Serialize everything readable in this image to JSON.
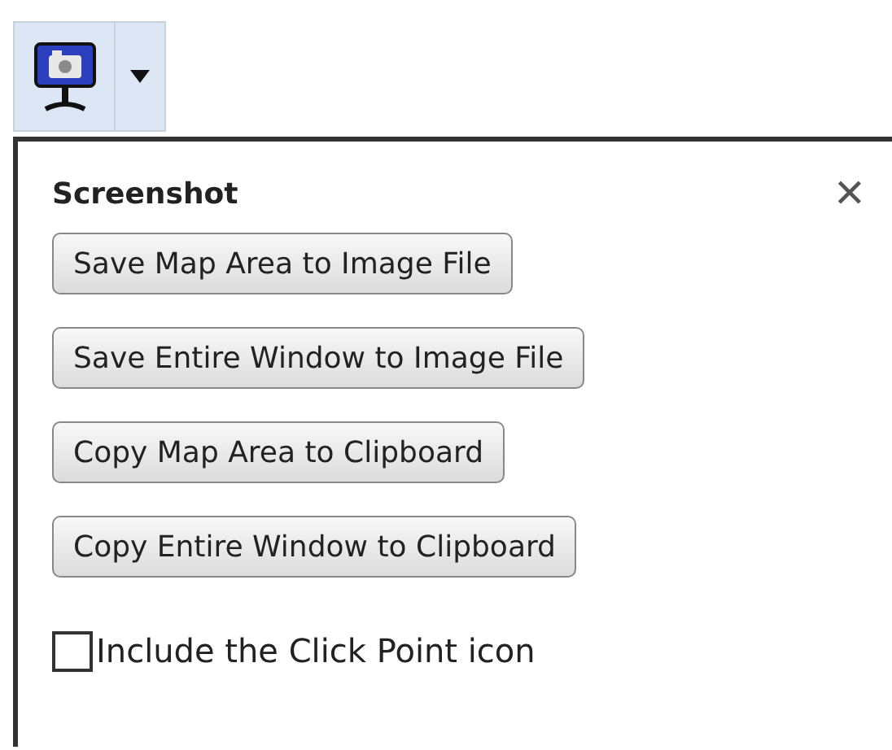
{
  "panel": {
    "title": "Screenshot",
    "close": "✕"
  },
  "buttons": [
    "Save Map Area to Image File",
    "Save Entire Window to Image File",
    "Copy Map Area to Clipboard",
    "Copy Entire Window to Clipboard"
  ],
  "option": {
    "label": "Include the Click Point icon",
    "checked": false
  }
}
